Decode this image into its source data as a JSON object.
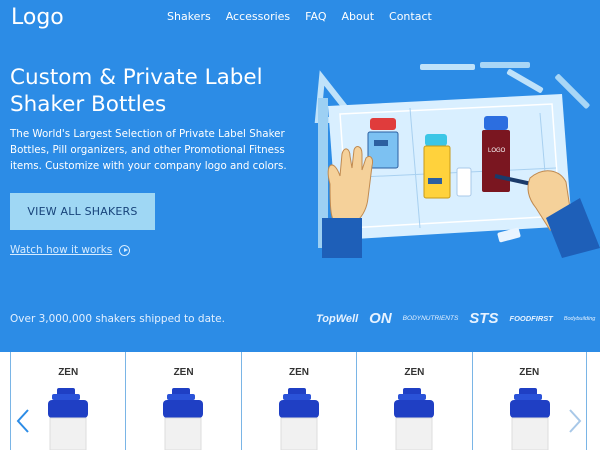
{
  "header": {
    "logo": "Logo",
    "nav": [
      "Shakers",
      "Accessories",
      "FAQ",
      "About",
      "Contact"
    ]
  },
  "hero": {
    "headline_line1": "Custom & Private Label",
    "headline_line2": "Shaker Bottles",
    "subtext": "The World's Largest Selection of Private Label Shaker Bottles, Pill organizers, and other Promotional Fitness items. Customize with your company logo and colors.",
    "cta_label": "VIEW ALL SHAKERS",
    "watch_label": "Watch how it works",
    "shipped": "Over 3,000,000 shakers shipped to date."
  },
  "brands": [
    "TopWell",
    "ON",
    "BODYNUTRIENTS",
    "STS",
    "FOODFIRST",
    "Bodybuilding"
  ],
  "illustration": {
    "bottle_logo": "LOGO"
  },
  "products": [
    {
      "label": "ZEN"
    },
    {
      "label": "ZEN"
    },
    {
      "label": "ZEN"
    },
    {
      "label": "ZEN"
    },
    {
      "label": "ZEN"
    }
  ],
  "colors": {
    "hero_bg": "#2c8ce6",
    "cta_bg": "#9fd7f4",
    "cap_blue": "#1f3fc4",
    "card_border": "#7ab5e6"
  },
  "icons": {
    "prev": "chevron-left-icon",
    "next": "chevron-right-icon",
    "play": "play-circle-icon"
  }
}
